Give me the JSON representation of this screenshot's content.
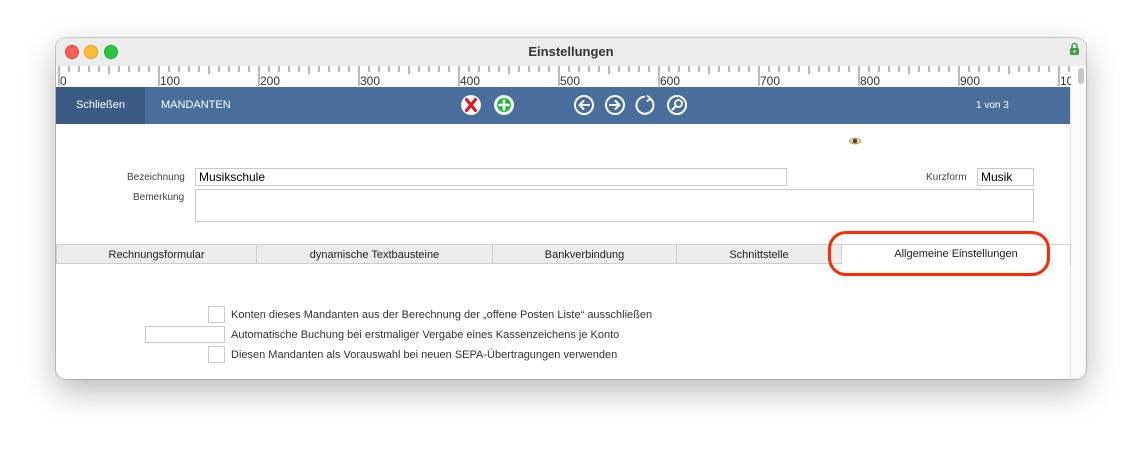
{
  "window": {
    "title": "Einstellungen"
  },
  "ruler": {
    "labels": [
      "0",
      "100",
      "200",
      "300",
      "400",
      "500",
      "600",
      "700",
      "800",
      "900",
      "10"
    ]
  },
  "toolbar": {
    "close_label": "Schließen",
    "section_title": "MANDANTEN",
    "record_count": "1 von 3",
    "icons": [
      "delete-icon",
      "add-icon",
      "back-arrow-icon",
      "forward-arrow-icon",
      "refresh-icon",
      "search-icon"
    ]
  },
  "form": {
    "bezeichnung_label": "Bezeichnung",
    "bezeichnung_value": "Musikschule",
    "kurzform_label": "Kurzform",
    "kurzform_value": "Musik",
    "bemerkung_label": "Bemerkung",
    "bemerkung_value": ""
  },
  "tabs": [
    {
      "label": "Rechnungsformular"
    },
    {
      "label": "dynamische Textbausteine"
    },
    {
      "label": "Bankverbindung"
    },
    {
      "label": "Schnittstelle"
    },
    {
      "label": "Allgemeine Einstellungen",
      "active": true
    }
  ],
  "options": {
    "exclude_open_items": "Konten dieses Mandanten aus der Berechnung der „offene Posten Liste“ ausschließen",
    "auto_booking": "Automatische Buchung bei erstmaliger Vergabe eines Kassenzeichens je Konto",
    "auto_booking_value": "",
    "sepa_default": "Diesen Mandanten als Vorauswahl bei neuen SEPA-Übertragungen verwenden"
  },
  "colors": {
    "toolbar": "#4a6e9b",
    "close_button": "#3b5b84",
    "highlight": "#ff2a00"
  }
}
